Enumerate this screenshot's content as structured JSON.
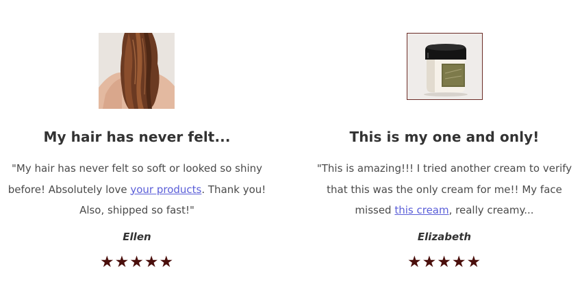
{
  "reviews": [
    {
      "title": "My hair has never felt...",
      "quote_before": "\"My hair has never felt so soft or looked so shiny before! Absolutely love ",
      "link_text": "your products",
      "quote_after": ". Thank you! Also, shipped so fast!\"",
      "author": "Ellen",
      "rating": 5,
      "star_glyph": "★",
      "image_icon": "long-hair-photo"
    },
    {
      "title": "This is my one and only!",
      "quote_before": "\"This is amazing!!! I tried another cream to verify that this was the only cream for me!! My face missed ",
      "link_text": "this cream",
      "quote_after": ", really creamy...",
      "author": "Elizabeth",
      "rating": 5,
      "star_glyph": "★",
      "image_icon": "cream-jar-photo"
    }
  ],
  "colors": {
    "star": "#4a0f0c",
    "link": "#5a5ed8",
    "text": "#4a4a4a",
    "heading": "#333333"
  }
}
